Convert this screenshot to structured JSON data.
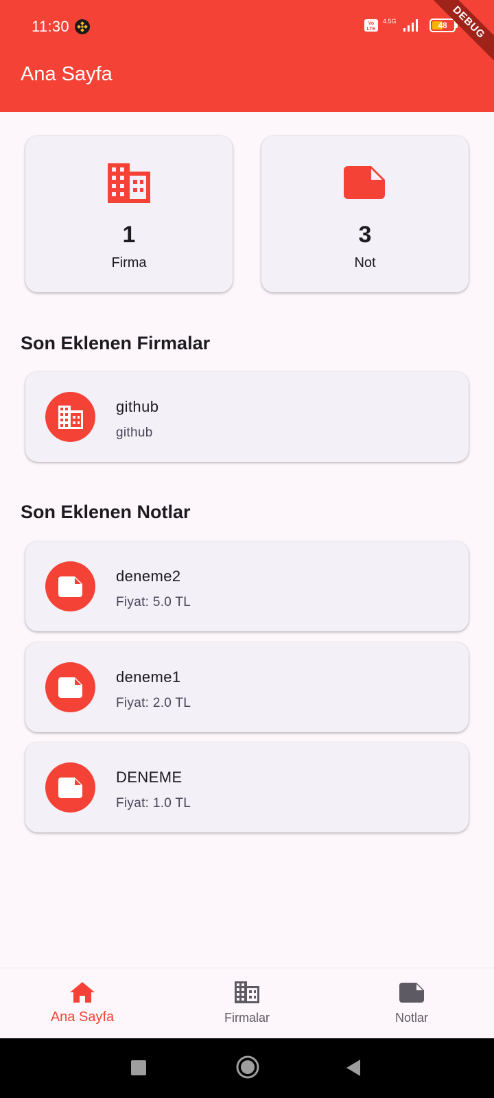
{
  "status_bar": {
    "time": "11:30",
    "network": "4.5G",
    "battery": "48",
    "battery_level_percent": 48,
    "debug_label": "DEBUG"
  },
  "app_bar": {
    "title": "Ana Sayfa"
  },
  "stats": [
    {
      "icon": "building-icon",
      "value": "1",
      "label": "Firma"
    },
    {
      "icon": "note-icon",
      "value": "3",
      "label": "Not"
    }
  ],
  "companies_section": {
    "heading": "Son Eklenen Firmalar",
    "items": [
      {
        "title": "github",
        "subtitle": "github"
      }
    ]
  },
  "notes_section": {
    "heading": "Son Eklenen Notlar",
    "items": [
      {
        "title": "deneme2",
        "subtitle": "Fiyat: 5.0 TL"
      },
      {
        "title": "deneme1",
        "subtitle": "Fiyat: 2.0 TL"
      },
      {
        "title": "DENEME",
        "subtitle": "Fiyat: 1.0 TL"
      }
    ]
  },
  "bottom_nav": {
    "items": [
      {
        "label": "Ana Sayfa",
        "icon": "home-icon",
        "active": true
      },
      {
        "label": "Firmalar",
        "icon": "building-icon",
        "active": false
      },
      {
        "label": "Notlar",
        "icon": "note-icon",
        "active": false
      }
    ]
  },
  "colors": {
    "primary": "#F44336",
    "background": "#FDF7FC",
    "card": "#F4F0F7",
    "inactive_nav": "#5E5A63"
  }
}
